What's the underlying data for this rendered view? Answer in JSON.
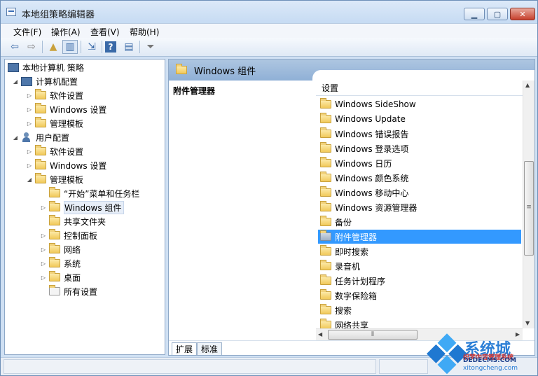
{
  "window": {
    "title": "本地组策略编辑器"
  },
  "menubar": [
    "文件(F)",
    "操作(A)",
    "查看(V)",
    "帮助(H)"
  ],
  "toolbar": {
    "buttons": [
      "back-arrow-icon",
      "forward-arrow-icon",
      "up-folder-icon",
      "show-hide-tree-icon",
      "export-list-icon",
      "help-icon",
      "properties-icon",
      "filter-icon"
    ]
  },
  "tree": {
    "root": "本地计算机 策略",
    "computer": "计算机配置",
    "computer_children": [
      "软件设置",
      "Windows 设置",
      "管理模板"
    ],
    "user": "用户配置",
    "user_children": [
      "软件设置",
      "Windows 设置",
      "管理模板"
    ],
    "admin_children": [
      "“开始”菜单和任务栏",
      "Windows 组件",
      "共享文件夹",
      "控制面板",
      "网络",
      "系统",
      "桌面",
      "所有设置"
    ]
  },
  "main": {
    "header": "Windows 组件",
    "description_title": "附件管理器",
    "column_header": "设置",
    "items": [
      "Windows SideShow",
      "Windows Update",
      "Windows 错误报告",
      "Windows 登录选项",
      "Windows 日历",
      "Windows 颜色系统",
      "Windows 移动中心",
      "Windows 资源管理器",
      "备份",
      "附件管理器",
      "即时搜索",
      "录音机",
      "任务计划程序",
      "数字保险箱",
      "搜索",
      "网络共享"
    ],
    "selected_index": 9,
    "tabs": [
      "扩展",
      "标准"
    ]
  },
  "watermark": {
    "cn": "系统城",
    "site": "织梦内容管理系统",
    "en": "DEDECMS.COM",
    "url": "xitongcheng.com"
  },
  "colors": {
    "selection": "#3399ff",
    "header": "#8fb0d6"
  }
}
